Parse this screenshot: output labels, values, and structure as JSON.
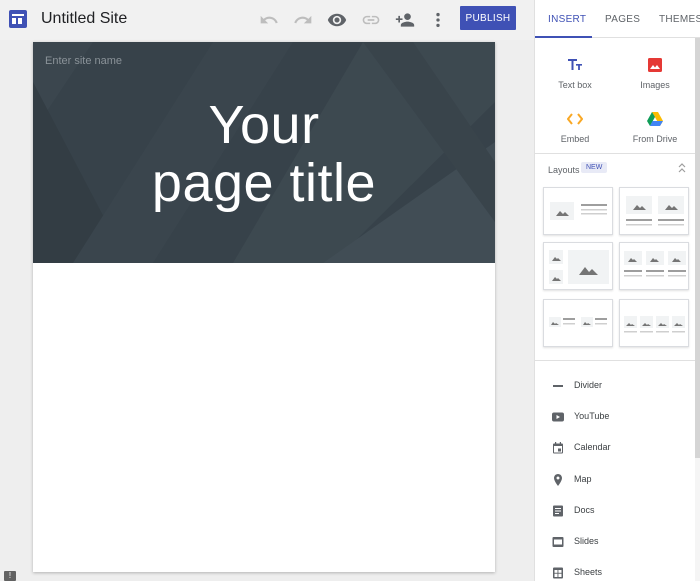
{
  "header": {
    "site_title": "Untitled Site",
    "publish_label": "PUBLISH",
    "icons": [
      "undo-icon",
      "redo-icon",
      "preview-icon",
      "link-icon",
      "share-icon",
      "more-icon"
    ]
  },
  "canvas": {
    "site_name_placeholder": "Enter site name",
    "title_line1": "Your",
    "title_line2": "page title"
  },
  "panel": {
    "tabs": [
      {
        "label": "INSERT",
        "active": true
      },
      {
        "label": "PAGES",
        "active": false
      },
      {
        "label": "THEMES",
        "active": false
      }
    ],
    "insert_items": [
      {
        "label": "Text box",
        "icon": "text-box-icon"
      },
      {
        "label": "Images",
        "icon": "image-icon"
      },
      {
        "label": "Embed",
        "icon": "embed-icon"
      },
      {
        "label": "From Drive",
        "icon": "drive-icon"
      }
    ],
    "layouts_label": "Layouts",
    "new_badge": "NEW",
    "components": [
      {
        "label": "Divider",
        "icon": "divider-icon"
      },
      {
        "label": "YouTube",
        "icon": "youtube-icon"
      },
      {
        "label": "Calendar",
        "icon": "calendar-icon"
      },
      {
        "label": "Map",
        "icon": "map-pin-icon"
      },
      {
        "label": "Docs",
        "icon": "docs-icon"
      },
      {
        "label": "Slides",
        "icon": "slides-icon"
      },
      {
        "label": "Sheets",
        "icon": "sheets-icon"
      }
    ]
  },
  "colors": {
    "accent": "#3f51b5",
    "hero_bg": "#37424a",
    "images_red": "#e53935",
    "embed_orange": "#f9a825"
  }
}
